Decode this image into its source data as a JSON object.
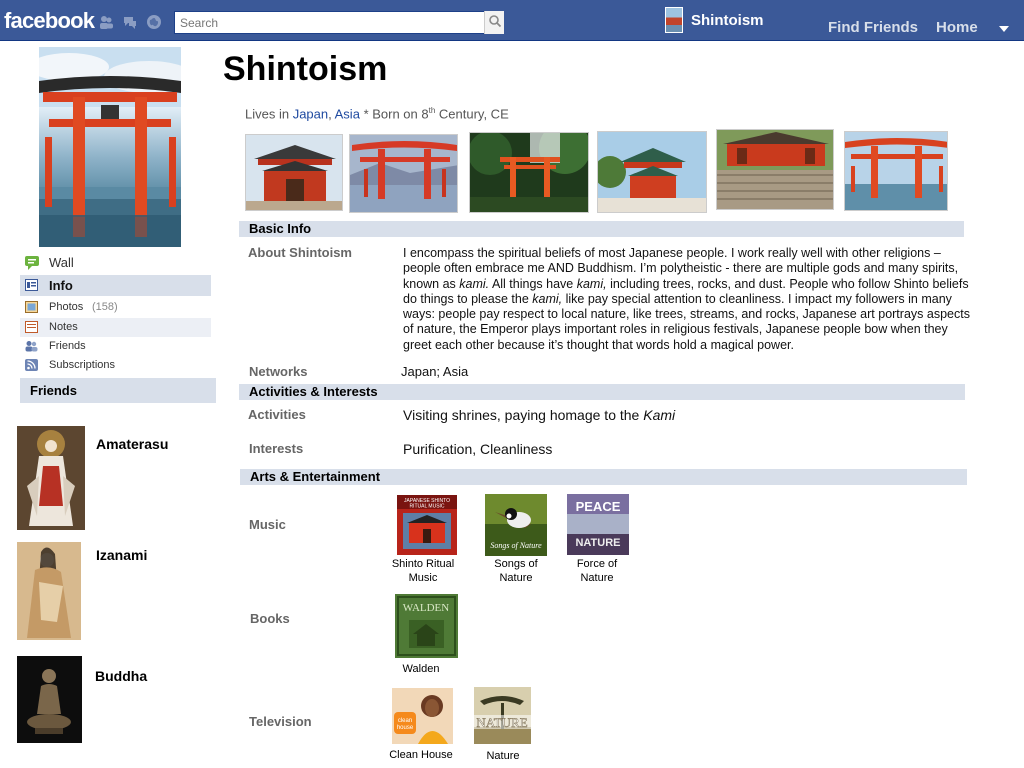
{
  "header": {
    "logo": "facebook",
    "search_placeholder": "Search",
    "page_name": "Shintoism",
    "nav": [
      "Find Friends",
      "Home"
    ]
  },
  "sidebar": {
    "items": [
      {
        "label": "Wall",
        "icon": "wall-icon"
      },
      {
        "label": "Info",
        "icon": "info-icon"
      },
      {
        "label": "Photos",
        "count": "(158)",
        "icon": "photos-icon"
      },
      {
        "label": "Notes",
        "icon": "notes-icon"
      },
      {
        "label": "Friends",
        "icon": "friends-icon"
      },
      {
        "label": "Subscriptions",
        "icon": "subscriptions-icon"
      }
    ],
    "friends_heading": "Friends",
    "friends": [
      "Amaterasu",
      "Izanami",
      "Buddha"
    ]
  },
  "profile": {
    "title": "Shintoism",
    "lives_in_prefix": "Lives in",
    "country": "Japan",
    "region": "Asia",
    "born_prefix": "* Born on 8",
    "born_sup": "th",
    "born_suffix": "Century, CE"
  },
  "basic_info": {
    "heading": "Basic Info",
    "about_label": "About Shintoism",
    "about_parts": [
      "I encompass the spiritual beliefs of most Japanese people. I work really well with other religions – people often embrace me AND Buddhism. I’m polytheistic  - there are multiple gods and many spirits, known as ",
      "kami.",
      " All things have ",
      "kami,",
      " including trees, rocks, and dust.  People who follow  Shinto beliefs do things to please the ",
      "kami,",
      " like pay special attention to cleanliness. I impact my followers in many ways:  people pay respect to local nature, like trees, streams, and rocks, Japanese art portrays aspects of nature, the Emperor plays important roles in religious festivals,  Japanese people bow when they greet each other because it’s thought that words hold a magical power."
    ],
    "networks_label": "Networks",
    "networks_value": "Japan; Asia"
  },
  "activities": {
    "heading": "Activities & Interests",
    "activities_label": "Activities",
    "activities_value": "Visiting shrines, paying homage to the ",
    "activities_value_em": "Kami",
    "interests_label": "Interests",
    "interests_value": "Purification, Cleanliness"
  },
  "arts": {
    "heading": "Arts & Entertainment",
    "music_label": "Music",
    "music": [
      {
        "caption": "Shinto Ritual Music",
        "cover_text": "JAPANESE SHINTO RITUAL MUSIC"
      },
      {
        "caption": "Songs of Nature",
        "cover_text": "Songs of Nature"
      },
      {
        "caption": "Force of Nature",
        "cover_text": "PEACE NATURE"
      }
    ],
    "books_label": "Books",
    "books": [
      {
        "caption": "Walden",
        "cover_text": "WALDEN"
      }
    ],
    "tv_label": "Television",
    "tv": [
      {
        "caption": "Clean House",
        "cover_text": "clean house"
      },
      {
        "caption": "Nature",
        "cover_text": "NATURE"
      }
    ]
  }
}
